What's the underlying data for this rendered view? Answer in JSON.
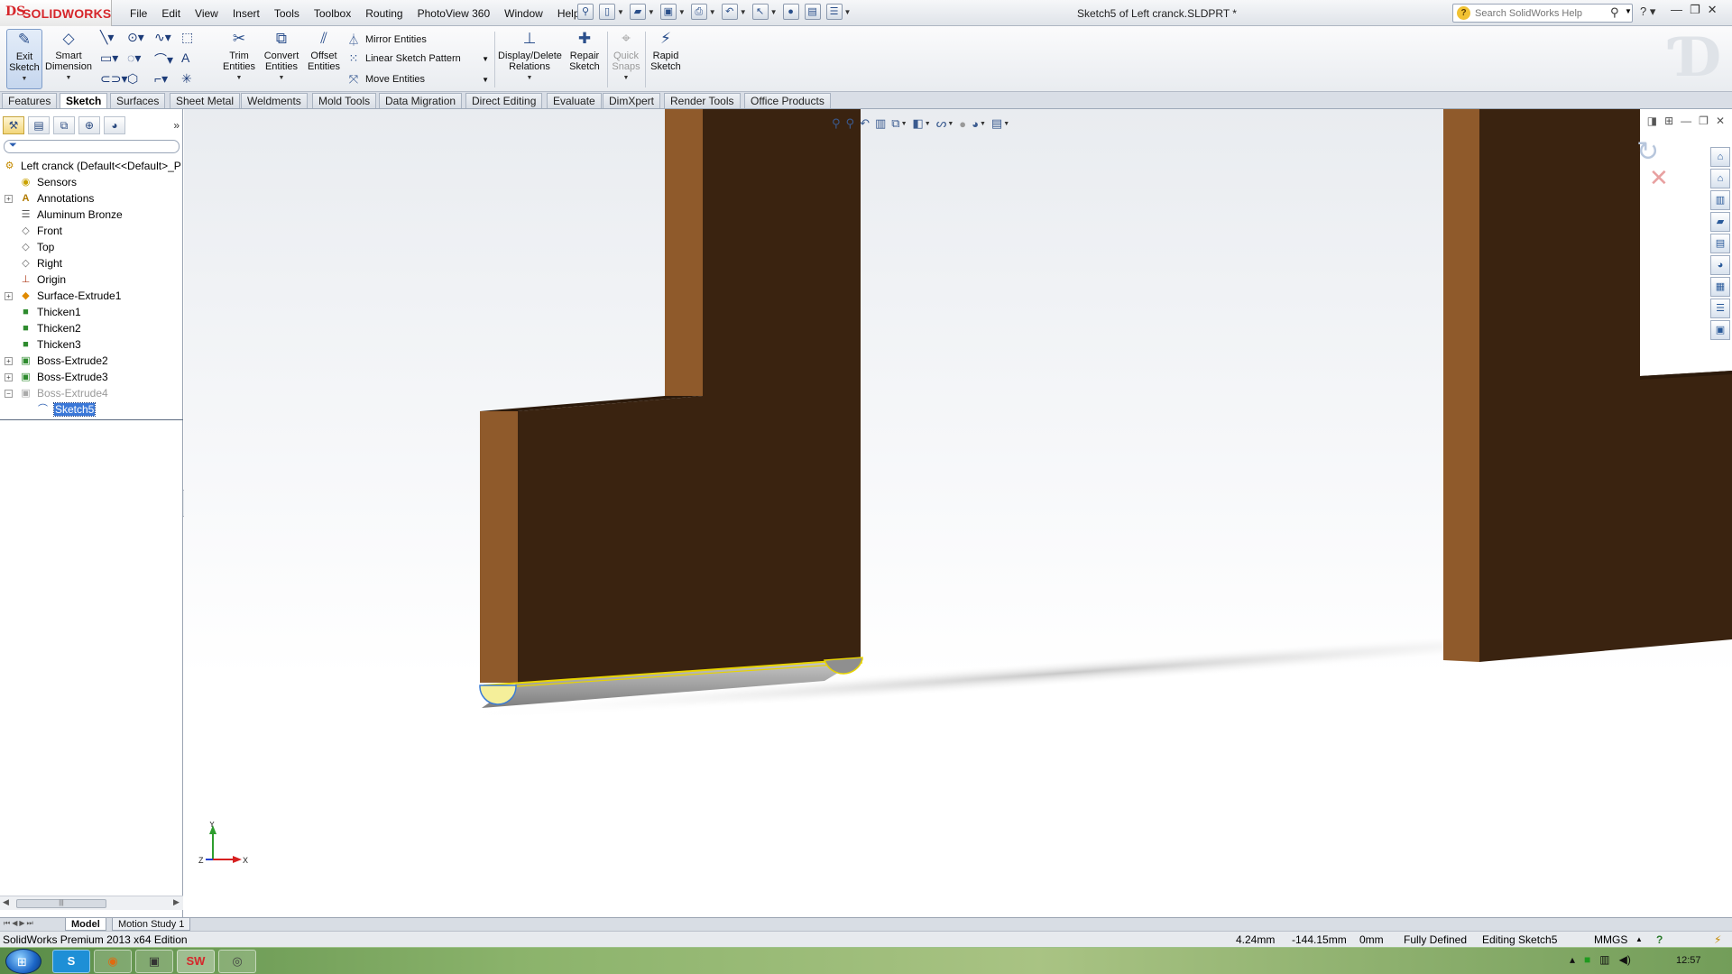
{
  "app": {
    "brand_mark": "DS",
    "brand_name": "SOLIDWORKS",
    "doc_title": "Sketch5 of Left cranck.SLDPRT *"
  },
  "menu": [
    "File",
    "Edit",
    "View",
    "Insert",
    "Tools",
    "Toolbox",
    "Routing",
    "PhotoView 360",
    "Window",
    "Help"
  ],
  "help_search": {
    "placeholder": "Search SolidWorks Help"
  },
  "ribbon": {
    "exit_sketch": "Exit Sketch",
    "smart_dimension": "Smart Dimension",
    "trim_entities": "Trim Entities",
    "convert_entities": "Convert Entities",
    "offset_entities": "Offset Entities",
    "mirror_entities": "Mirror Entities",
    "linear_sketch_pattern": "Linear Sketch Pattern",
    "move_entities": "Move Entities",
    "display_delete_relations": "Display/Delete Relations",
    "repair_sketch": "Repair Sketch",
    "quick_snaps": "Quick Snaps",
    "rapid_sketch": "Rapid Sketch"
  },
  "tabs": [
    "Features",
    "Sketch",
    "Surfaces",
    "Sheet Metal",
    "Weldments",
    "Mold Tools",
    "Data Migration",
    "Direct Editing",
    "Evaluate",
    "DimXpert",
    "Render Tools",
    "Office Products"
  ],
  "active_tab": "Sketch",
  "tree": {
    "root": "Left cranck  (Default<<Default>_P",
    "items": [
      "Sensors",
      "Annotations",
      "Aluminum Bronze",
      "Front",
      "Top",
      "Right",
      "Origin",
      "Surface-Extrude1",
      "Thicken1",
      "Thicken2",
      "Thicken3",
      "Boss-Extrude2",
      "Boss-Extrude3",
      "Boss-Extrude4",
      "Sketch5"
    ]
  },
  "triad": {
    "x": "X",
    "y": "Y",
    "z": "Z"
  },
  "model_tabs": [
    "Model",
    "Motion Study 1"
  ],
  "status": {
    "edition": "SolidWorks Premium 2013 x64 Edition",
    "x": "4.24mm",
    "y": "-144.15mm",
    "z": "0mm",
    "state": "Fully Defined",
    "editing": "Editing Sketch5",
    "units": "MMGS"
  },
  "taskbar": {
    "clock": "12:57"
  },
  "colors": {
    "part_face": "#3a2310",
    "part_side": "#8f5a2b",
    "sketch_fill": "#f5ef9a",
    "sketch_line": "#e8d400",
    "brand": "#d6262b"
  }
}
